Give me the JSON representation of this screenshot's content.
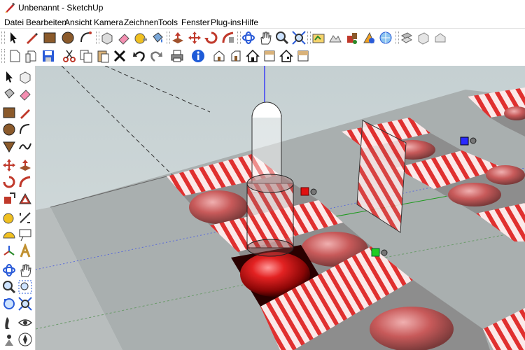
{
  "window": {
    "title": "Unbenannt - SketchUp"
  },
  "menubar": {
    "items": [
      {
        "label": "Datei"
      },
      {
        "label": "Bearbeiten"
      },
      {
        "label": "Ansicht"
      },
      {
        "label": "Kamera"
      },
      {
        "label": "Zeichnen"
      },
      {
        "label": "Tools"
      },
      {
        "label": "Fenster"
      },
      {
        "label": "Plug-ins"
      },
      {
        "label": "Hilfe"
      }
    ]
  },
  "toolbars": {
    "main": [
      "select-icon",
      "pencil-line-icon",
      "rectangle-icon",
      "circle-icon",
      "arc-icon",
      "make-component-icon",
      "eraser-icon",
      "tape-measure-icon",
      "paint-bucket-icon",
      "push-pull-icon",
      "rotate-icon",
      "offset-icon",
      "follow-me-icon",
      "orbit-icon",
      "pan-hand-icon",
      "zoom-icon",
      "zoom-extents-icon",
      "add-location-icon",
      "toggle-terrain-icon",
      "components-icon",
      "get-models-icon",
      "share-model-icon",
      "section-plane-icon",
      "display-section-planes-icon",
      "display-section-cuts-icon"
    ],
    "standard": [
      "new-file-icon",
      "open-file-icon",
      "save-icon",
      "cut-icon",
      "copy-icon",
      "paste-icon",
      "delete-icon",
      "undo-icon",
      "redo-icon",
      "print-icon",
      "model-info-icon",
      "iso-view-icon",
      "front-view-icon",
      "top-view-icon",
      "right-view-icon",
      "back-view-icon",
      "left-view-icon"
    ],
    "left": [
      "select-icon",
      "make-component-icon",
      "paint-bucket-icon",
      "eraser-icon",
      "rectangle-icon",
      "line-icon",
      "circle-icon",
      "arc-icon",
      "polygon-icon",
      "freehand-icon",
      "move-icon",
      "push-pull-icon",
      "rotate-icon",
      "follow-me-icon",
      "scale-icon",
      "offset-icon",
      "tape-measure-icon",
      "dimension-icon",
      "protractor-icon",
      "text-icon",
      "axes-icon",
      "3d-text-icon",
      "orbit-icon",
      "pan-hand-icon",
      "zoom-icon",
      "zoom-window-icon",
      "previous-view-icon",
      "zoom-extents-icon",
      "walk-icon",
      "look-around-icon",
      "position-camera-icon",
      "section-plane-icon"
    ]
  },
  "colors": {
    "sky": "#cfd8d9",
    "ground": "#adb3b3",
    "stripe_red": "#e0302f",
    "red_ball": "#d51a1a",
    "axis_blue": "#1a1aff",
    "axis_green": "#1d9a1d",
    "axis_red": "#cc1a1a",
    "selection_blue": "#2a2aff"
  }
}
